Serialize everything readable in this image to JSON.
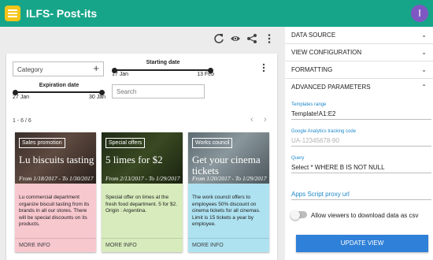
{
  "app": {
    "title": "ILFS- Post-its",
    "user_initial": "I"
  },
  "filters": {
    "category_label": "Category",
    "starting_date": {
      "label": "Starting date",
      "min": "17 Jan",
      "max": "13 Feb"
    },
    "expiration_date": {
      "label": "Expiration date",
      "min": "27 Jan",
      "max": "30 Jan"
    },
    "search_placeholder": "Search"
  },
  "pagination": {
    "range": "1 - 6 / 6"
  },
  "cards": [
    {
      "tag": "Sales promotion",
      "title": "Lu biscuits tasting",
      "dates": "From 1/18/2017 - To 1/30/2017",
      "body": "Lu commercial department organize biscuit tasting from its brands in all our stores. There will be special discounts on its products.",
      "footer": "MORE INFO",
      "color": "#f8c8cf"
    },
    {
      "tag": "Special offers",
      "title": "5 limes for $2",
      "dates": "From 2/13/2017 - To 1/29/2017",
      "body": "Special offer on limes at the fresh food department. 5 for $2. Origin : Argentina.",
      "footer": "MORE INFO",
      "color": "#d7ebbc"
    },
    {
      "tag": "Works council",
      "title": "Get your cinema tickets",
      "dates": "From 1/20/2017 - To 1/29/2017",
      "body": "The work council offers to employees 50% discount on cinema tickets for all cinemas. Limit is 15 tickets a year by employee.",
      "footer": "MORE INFO",
      "color": "#aee2f1"
    }
  ],
  "sidebar": {
    "sections": [
      "DATA SOURCE",
      "VIEW CONFIGURATION",
      "FORMATTING",
      "ADVANCED PARAMETERS"
    ],
    "templates_range": {
      "label": "Templates range",
      "value": "Template!A1:E2"
    },
    "analytics": {
      "label": "Google Analytics tracking code",
      "placeholder": "UA-12345678-90"
    },
    "query": {
      "label": "Query",
      "value": "Select * WHERE B IS NOT NULL"
    },
    "proxy": {
      "placeholder": "Apps Script proxy url"
    },
    "download_toggle": {
      "label": "Allow viewers to download data as csv",
      "on": false
    },
    "update_button": "UPDATE VIEW"
  },
  "colors": {
    "accent": "#17a589",
    "primary_button": "#2f80d8",
    "avatar": "#7e57c2",
    "link_label": "#1e88c9"
  }
}
